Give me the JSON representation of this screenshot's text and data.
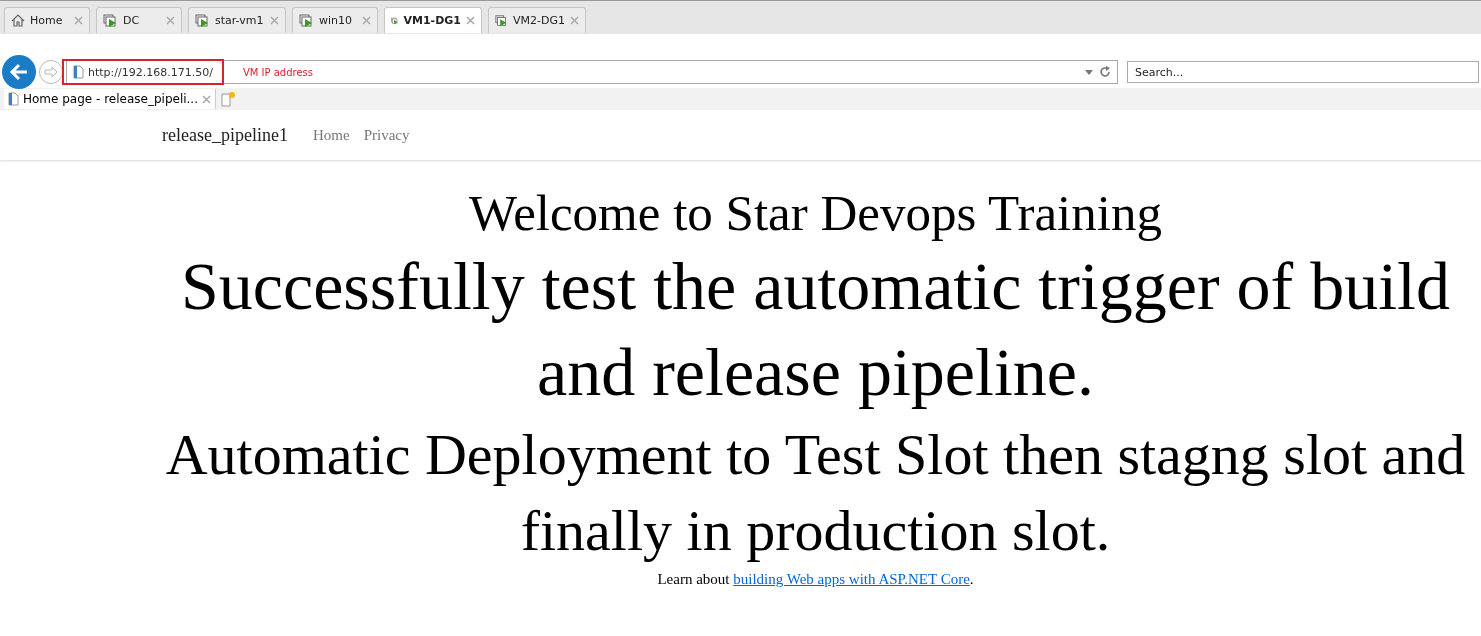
{
  "vm_tabs": [
    {
      "kind": "home",
      "label": "Home",
      "selected": false
    },
    {
      "kind": "vm",
      "label": "DC",
      "selected": false
    },
    {
      "kind": "vm",
      "label": "star-vm1",
      "selected": false
    },
    {
      "kind": "vm",
      "label": "win10",
      "selected": false
    },
    {
      "kind": "vm",
      "label": "VM1-DG1",
      "selected": true
    },
    {
      "kind": "vm",
      "label": "VM2-DG1",
      "selected": false
    }
  ],
  "address_bar": {
    "value": "http://192.168.171.50/",
    "annotation": "VM IP address"
  },
  "search": {
    "placeholder": "Search..."
  },
  "browser_tab": {
    "title": "Home page - release_pipeli..."
  },
  "navbar": {
    "brand": "release_pipeline1",
    "links": [
      "Home",
      "Privacy"
    ]
  },
  "page": {
    "welcome": "Welcome to Star Devops Training",
    "heading": "Successfully test the automatic trigger of build and release pipeline.",
    "subheading": "Automatic Deployment to Test Slot then stagng slot and finally in production slot.",
    "learn_prefix": "Learn about ",
    "learn_link": "building Web apps with ASP.NET Core",
    "learn_suffix": "."
  }
}
